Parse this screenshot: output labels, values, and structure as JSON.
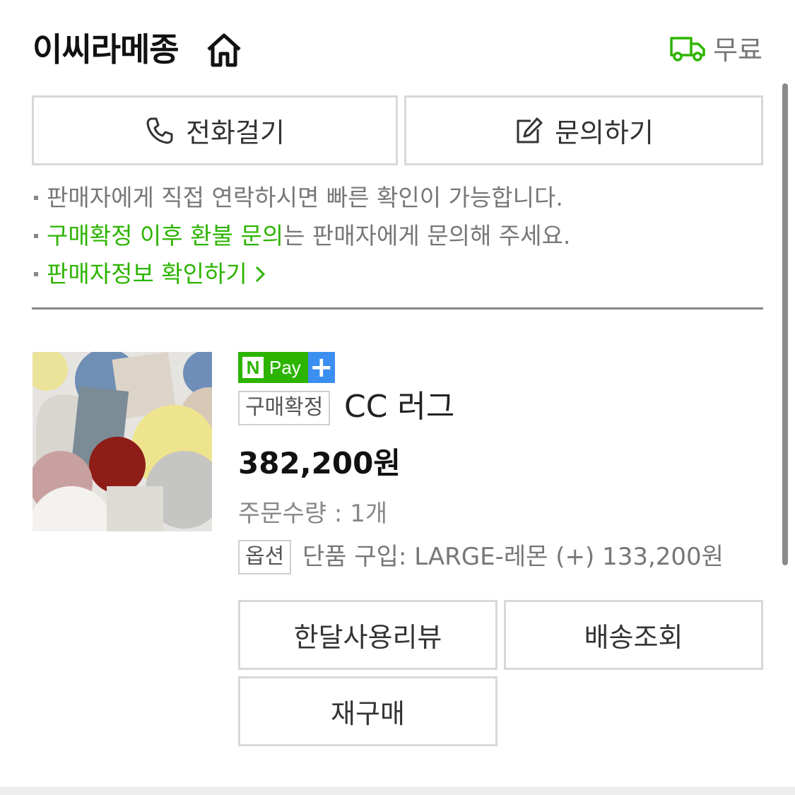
{
  "header": {
    "store_name": "이씨라메종",
    "shipping_label": "무료"
  },
  "contact": {
    "call_label": "전화걸기",
    "inquiry_label": "문의하기"
  },
  "notices": {
    "line1": "판매자에게 직접 연락하시면 빠른 확인이 가능합니다.",
    "line2_green": "구매확정 이후 환불 문의",
    "line2_rest": "는 판매자에게 문의해 주세요.",
    "line3": "판매자정보 확인하기"
  },
  "product": {
    "npay_letter": "N",
    "npay_text": "Pay",
    "status": "구매확정",
    "name": "CC 러그",
    "price": "382,200원",
    "quantity": "주문수량 : 1개",
    "option_tag": "옵션",
    "option_text": "단품 구입: LARGE-레몬 (+) 133,200원"
  },
  "actions": {
    "review_label": "한달사용리뷰",
    "track_label": "배송조회",
    "rebuy_label": "재구매"
  },
  "colors": {
    "accent_green": "#2db400",
    "npay_plus_blue": "#3b8ff0"
  }
}
